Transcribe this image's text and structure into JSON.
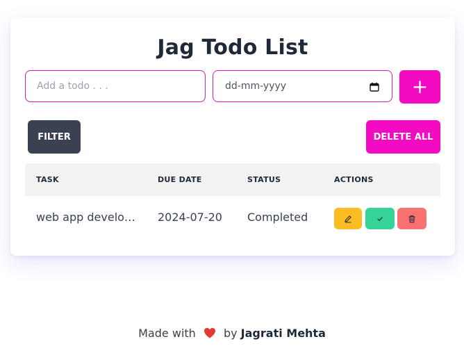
{
  "header": {
    "title": "Jag Todo List"
  },
  "form": {
    "todo_placeholder": "Add a todo . . .",
    "todo_value": "",
    "date_placeholder": "dd-mm-yyyy",
    "add_label": "+"
  },
  "toolbar": {
    "filter_label": "FILTER",
    "delete_all_label": "DELETE ALL"
  },
  "table": {
    "columns": [
      "TASK",
      "DUE DATE",
      "STATUS",
      "ACTIONS"
    ],
    "rows": [
      {
        "task": "web app development",
        "due_date": "2024-07-20",
        "status": "Completed"
      }
    ]
  },
  "footer": {
    "made_with": "Made with",
    "by": "by",
    "author": "Jagrati Mehta"
  },
  "icons": {
    "add": "plus-icon",
    "date": "calendar-icon",
    "edit": "pencil-icon",
    "complete": "check-icon",
    "delete": "trash-icon",
    "love": "heart-icon"
  },
  "colors": {
    "accent": "#f20bc3",
    "input_border": "#d11dae",
    "filter_bg": "#3a4252",
    "edit_bg": "#fbbd23",
    "complete_bg": "#36d399",
    "delete_bg": "#f87272",
    "heart": "#e53935"
  }
}
